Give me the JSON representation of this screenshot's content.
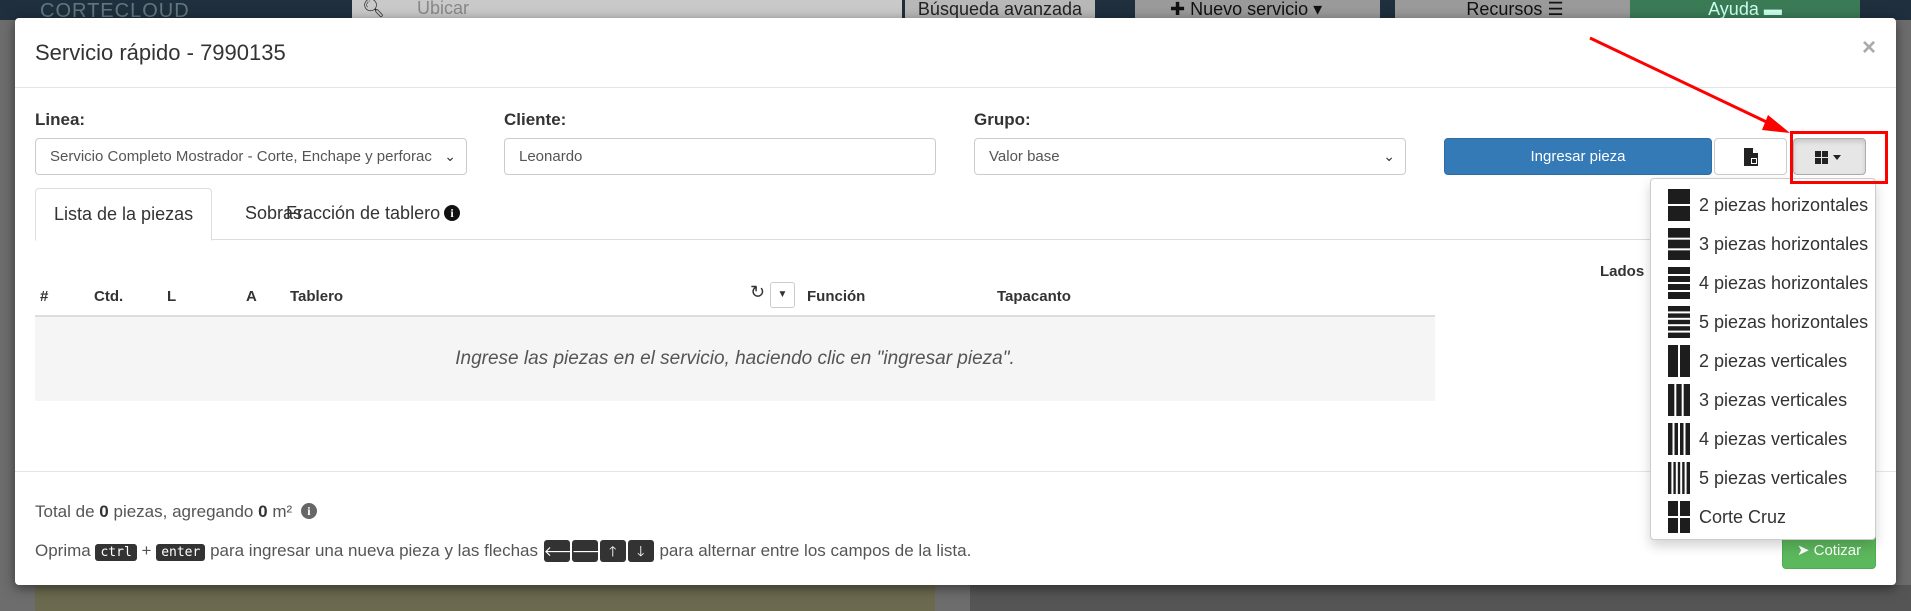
{
  "background": {
    "logo": "CORTECLOUD",
    "search_placeholder": "Ubicar",
    "advanced_search": "Búsqueda avanzada",
    "new_service": "Nuevo servicio",
    "resources": "Recursos",
    "help": "Ayuda"
  },
  "modal": {
    "title": "Servicio rápido - 7990135",
    "close_label": "×"
  },
  "form": {
    "line_label": "Linea:",
    "line_value": "Servicio Completo Mostrador - Corte, Enchape y perforac",
    "client_label": "Cliente:",
    "client_value": "Leonardo",
    "group_label": "Grupo:",
    "group_value": "Valor base",
    "add_piece_button": "Ingresar pieza"
  },
  "tabs": [
    {
      "label": "Lista de la piezas",
      "active": true
    },
    {
      "label": "Sobras",
      "active": false
    },
    {
      "label": "Fracción de tablero",
      "active": false
    }
  ],
  "table": {
    "headers": [
      "#",
      "Ctd.",
      "L",
      "A",
      "Tablero",
      "Función",
      "Tapacanto"
    ],
    "sides_header": "Lados",
    "empty_message": "Ingrese las piezas en el servicio, haciendo clic en \"ingresar pieza\"."
  },
  "footer": {
    "total_prefix": "Total de",
    "total_count": "0",
    "total_mid": "piezas, agregando",
    "total_area": "0",
    "total_unit": "m²",
    "hint_prefix": "Oprima",
    "key_ctrl": "ctrl",
    "plus": "+",
    "key_enter": "enter",
    "hint_mid": "para ingresar una nueva pieza y las flechas",
    "hint_suffix": "para alternar entre los campos de la lista.",
    "quote_button": "Cotizar"
  },
  "layout_menu": [
    {
      "label": "2 piezas horizontales",
      "icon": "two-horizontal-icon",
      "kind": "h",
      "n": 2
    },
    {
      "label": "3 piezas horizontales",
      "icon": "three-horizontal-icon",
      "kind": "h",
      "n": 3
    },
    {
      "label": "4 piezas horizontales",
      "icon": "four-horizontal-icon",
      "kind": "h",
      "n": 4
    },
    {
      "label": "5 piezas horizontales",
      "icon": "five-horizontal-icon",
      "kind": "h",
      "n": 5
    },
    {
      "label": "2 piezas verticales",
      "icon": "two-vertical-icon",
      "kind": "v",
      "n": 2
    },
    {
      "label": "3 piezas verticales",
      "icon": "three-vertical-icon",
      "kind": "v",
      "n": 3
    },
    {
      "label": "4 piezas verticales",
      "icon": "four-vertical-icon",
      "kind": "v",
      "n": 4
    },
    {
      "label": "5 piezas verticales",
      "icon": "five-vertical-icon",
      "kind": "v",
      "n": 5
    },
    {
      "label": "Corte Cruz",
      "icon": "cross-cut-icon",
      "kind": "x",
      "n": 4
    }
  ],
  "colors": {
    "primary": "#337ab7",
    "success": "#5cb85c",
    "annotation": "#ff0000"
  }
}
